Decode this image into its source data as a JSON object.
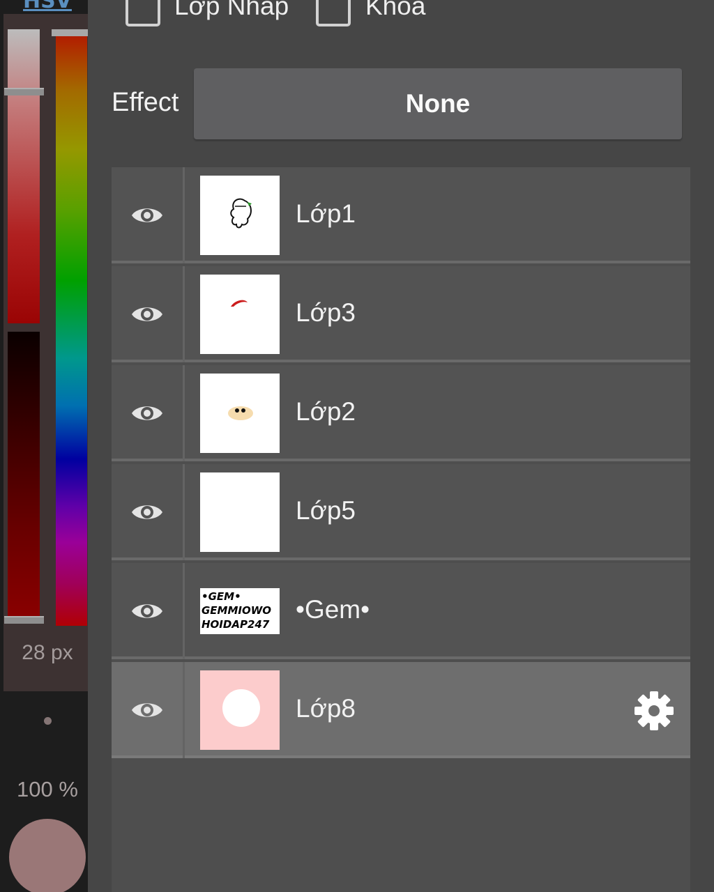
{
  "color_panel": {
    "mode_tab": "HSV",
    "brush_size": "28 px",
    "opacity": "100 %",
    "current_color": "#9a7777"
  },
  "options": {
    "draft_layer_label": "Lớp Nháp",
    "draft_layer_checked": false,
    "lock_label": "Khóa",
    "lock_checked": false
  },
  "effect": {
    "label": "Effect",
    "value": "None"
  },
  "layers": [
    {
      "name": "Lớp1",
      "visible": true,
      "selected": false
    },
    {
      "name": "Lớp3",
      "visible": true,
      "selected": false
    },
    {
      "name": "Lớp2",
      "visible": true,
      "selected": false
    },
    {
      "name": "Lớp5",
      "visible": true,
      "selected": false
    },
    {
      "name": "•Gem•",
      "visible": true,
      "selected": false,
      "thumb_text": [
        "•GEM•",
        "GEMMIOWO",
        "HOIDAP247"
      ]
    },
    {
      "name": "Lớp8",
      "visible": true,
      "selected": true
    }
  ],
  "icons": {
    "visibility": "eye-icon",
    "settings": "gear-icon"
  }
}
